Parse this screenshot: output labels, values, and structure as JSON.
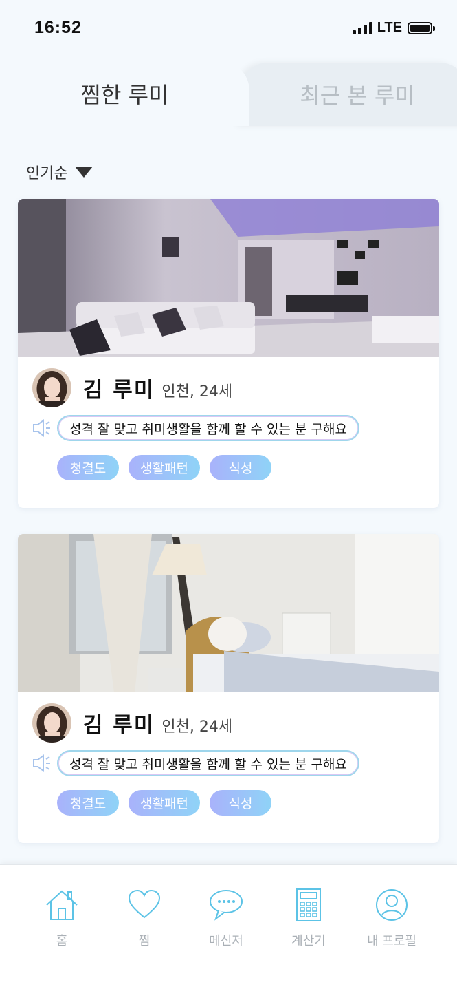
{
  "status_bar": {
    "time": "16:52",
    "network": "LTE"
  },
  "tabs": [
    {
      "label": "찜한 루미",
      "active": true
    },
    {
      "label": "최근 본 루미",
      "active": false
    }
  ],
  "sort": {
    "label": "인기순"
  },
  "cards": [
    {
      "photo": "living-room-photo",
      "name": "김 루미",
      "meta": "인천, 24세",
      "message": "성격 잘 맞고 취미생활을 함께 할 수 있는 분 구해요",
      "tags": [
        "청결도",
        "생활패턴",
        "식성"
      ]
    },
    {
      "photo": "bedroom-photo",
      "name": "김 루미",
      "meta": "인천, 24세",
      "message": "성격 잘 맞고 취미생활을 함께 할 수 있는 분 구해요",
      "tags": [
        "청결도",
        "생활패턴",
        "식성"
      ]
    }
  ],
  "bottom_nav": [
    {
      "label": "홈",
      "icon": "home-icon"
    },
    {
      "label": "찜",
      "icon": "heart-icon"
    },
    {
      "label": "메신저",
      "icon": "chat-icon"
    },
    {
      "label": "계산기",
      "icon": "calculator-icon"
    },
    {
      "label": "내 프로필",
      "icon": "profile-icon"
    }
  ],
  "colors": {
    "accent": "#5cc3e6",
    "tag_gradient_start": "#a9b2fb",
    "tag_gradient_end": "#8fd3f7"
  }
}
